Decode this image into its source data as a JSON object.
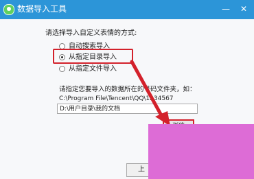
{
  "window": {
    "title": "数据导入工具",
    "minimize": "—",
    "close": "✕"
  },
  "main": {
    "prompt": "请选择导入自定义表情的方式:",
    "options": [
      {
        "label": "自动搜索导入",
        "checked": false
      },
      {
        "label": "从指定目录导入",
        "checked": true
      },
      {
        "label": "从指定文件导入",
        "checked": false
      }
    ],
    "instruction": "请指定您要导入的数据所在的号码文件夹，如：",
    "hint_path": "C:\\Program File\\Tencent\\QQ\\1234567",
    "path_value": "D:\\用户目录\\我的文档",
    "browse_label": "浏览",
    "bottom_button_label": "上"
  },
  "colors": {
    "titlebar": "#2c95d8",
    "highlight": "#d3212b",
    "arrow": "#d3212b"
  }
}
